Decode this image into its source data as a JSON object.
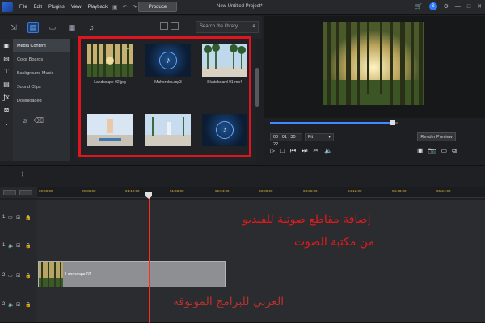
{
  "menubar": {
    "items": [
      "File",
      "Edit",
      "Plugins",
      "View",
      "Playback"
    ],
    "produce_label": "Produce",
    "project_title": "New Untitled Project*",
    "badge": "S"
  },
  "library": {
    "search_placeholder": "Search the library",
    "categories": [
      "Media Content",
      "Color Boards",
      "Background Music",
      "Sound Clips",
      "Downloaded"
    ],
    "media": [
      {
        "label": "Landscape 02.jpg",
        "type": "image",
        "checked": true
      },
      {
        "label": "Mahoroba.mp3",
        "type": "audio"
      },
      {
        "label": "Skateboard 01.mp4",
        "type": "video"
      },
      {
        "label": "",
        "type": "video"
      },
      {
        "label": "",
        "type": "video"
      },
      {
        "label": "",
        "type": "audio"
      }
    ]
  },
  "preview": {
    "timecode": "00 : 01 : 30 : 22",
    "fit": "Fit",
    "render_label": "Render Preview",
    "scrub_progress": 0.96
  },
  "timeline": {
    "ruler": [
      "00:00:00",
      "00:36:00",
      "01:12:00",
      "01:48:00",
      "02:24:00",
      "03:00:00",
      "03:36:00",
      "04:12:00",
      "04:48:00",
      "05:24:00"
    ],
    "tracks": [
      {
        "label": "1."
      },
      {
        "label": "1."
      },
      {
        "label": "2."
      },
      {
        "label": "2."
      }
    ],
    "clip_label": "Landscape 02"
  },
  "overlay": {
    "line1": "إضافة مقاطع صوتية للفيديو",
    "line2": "من مكتبة الصوت",
    "line3": "العربي للبرامج الموثوقة"
  },
  "colors": {
    "highlight_frame": "#e0141e",
    "playhead": "#ff2b2b",
    "accent": "#3d8bff"
  }
}
